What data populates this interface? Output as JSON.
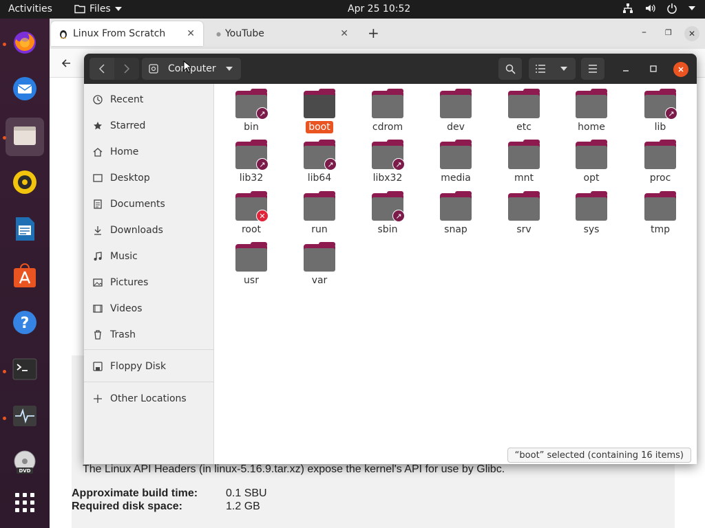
{
  "topbar": {
    "activities": "Activities",
    "app_menu": "Files",
    "clock": "Apr 25  10:52"
  },
  "dock": {
    "items": [
      {
        "icon": "firefox-icon",
        "active": false
      },
      {
        "icon": "thunderbird-icon",
        "active": false
      },
      {
        "icon": "files-icon",
        "active": true
      },
      {
        "icon": "rhythmbox-icon",
        "active": false
      },
      {
        "icon": "libreoffice-writer-icon",
        "active": false
      },
      {
        "icon": "software-store-icon",
        "active": false
      },
      {
        "icon": "help-icon",
        "active": false
      },
      {
        "icon": "terminal-icon",
        "active": false
      },
      {
        "icon": "system-monitor-icon",
        "active": false
      },
      {
        "icon": "dvd-icon",
        "active": false
      },
      {
        "icon": "app-grid-icon",
        "active": false
      }
    ]
  },
  "browser": {
    "tabs": [
      {
        "label": "Linux From Scratch"
      },
      {
        "label": "YouTube"
      }
    ],
    "page": {
      "description": "The Linux API Headers (in linux-5.16.9.tar.xz) expose the kernel's API for use by Glibc.",
      "build_time_label": "Approximate build time:",
      "build_time_value": "0.1 SBU",
      "disk_space_label": "Required disk space:",
      "disk_space_value": "1.2 GB"
    }
  },
  "files": {
    "location": "Computer",
    "sidebar": {
      "items": [
        {
          "label": "Recent",
          "icon": "clock-icon"
        },
        {
          "label": "Starred",
          "icon": "star-icon"
        },
        {
          "label": "Home",
          "icon": "home-icon"
        },
        {
          "label": "Desktop",
          "icon": "desktop-icon"
        },
        {
          "label": "Documents",
          "icon": "document-icon"
        },
        {
          "label": "Downloads",
          "icon": "download-icon"
        },
        {
          "label": "Music",
          "icon": "music-icon"
        },
        {
          "label": "Pictures",
          "icon": "picture-icon"
        },
        {
          "label": "Videos",
          "icon": "video-icon"
        },
        {
          "label": "Trash",
          "icon": "trash-icon"
        }
      ],
      "devices": [
        {
          "label": "Floppy Disk",
          "icon": "floppy-icon"
        }
      ],
      "other": {
        "label": "Other Locations",
        "icon": "plus-icon"
      }
    },
    "folders": [
      {
        "name": "bin",
        "badge": "link"
      },
      {
        "name": "boot",
        "badge": "",
        "selected": true
      },
      {
        "name": "cdrom",
        "badge": ""
      },
      {
        "name": "dev",
        "badge": ""
      },
      {
        "name": "etc",
        "badge": ""
      },
      {
        "name": "home",
        "badge": ""
      },
      {
        "name": "lib",
        "badge": "link"
      },
      {
        "name": "lib32",
        "badge": "link"
      },
      {
        "name": "lib64",
        "badge": "link"
      },
      {
        "name": "libx32",
        "badge": "link"
      },
      {
        "name": "media",
        "badge": ""
      },
      {
        "name": "mnt",
        "badge": ""
      },
      {
        "name": "opt",
        "badge": ""
      },
      {
        "name": "proc",
        "badge": ""
      },
      {
        "name": "root",
        "badge": "locked"
      },
      {
        "name": "run",
        "badge": ""
      },
      {
        "name": "sbin",
        "badge": "link"
      },
      {
        "name": "snap",
        "badge": ""
      },
      {
        "name": "srv",
        "badge": ""
      },
      {
        "name": "sys",
        "badge": ""
      },
      {
        "name": "tmp",
        "badge": ""
      },
      {
        "name": "usr",
        "badge": ""
      },
      {
        "name": "var",
        "badge": ""
      }
    ],
    "status": "“boot” selected  (containing 16 items)"
  },
  "colors": {
    "accent": "#e95420",
    "folder_tab": "#8e1b4f",
    "folder_body": "#6e6e6e",
    "header_bg": "#2c2c2c"
  }
}
